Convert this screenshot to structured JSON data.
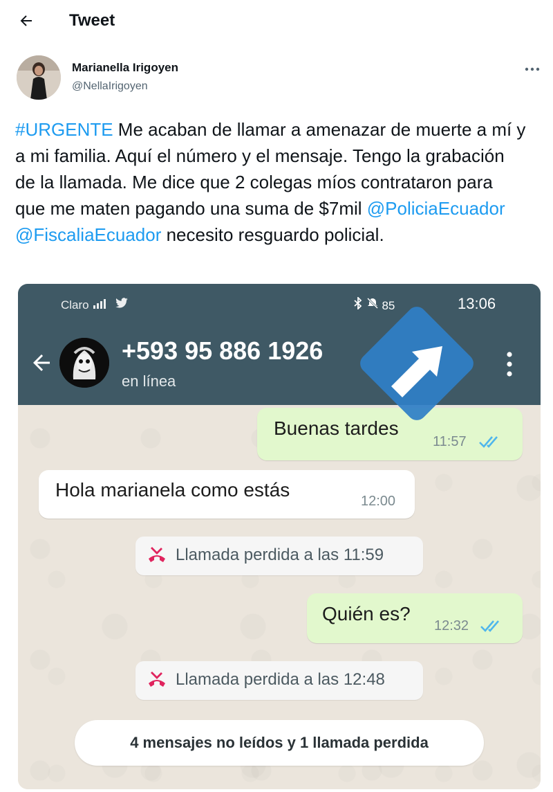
{
  "topbar": {
    "title": "Tweet"
  },
  "author": {
    "name": "Marianella Irigoyen",
    "handle": "@NellaIrigoyen"
  },
  "tweet": {
    "hashtag": "#URGENTE",
    "text_1": " Me acaban de llamar a amenazar de muerte a mí y a mi familia. Aquí el número y el mensaje. Tengo la grabación de la llamada. Me dice que 2 colegas míos contrataron para que me maten pagando una suma de $7mil ",
    "mention_1": "@PoliciaEcuador",
    "mention_2": "@FiscaliaEcuador",
    "text_2": " necesito resguardo policial."
  },
  "screenshot": {
    "status_bar": {
      "carrier": "Claro",
      "battery": "85",
      "time": "13:06"
    },
    "contact": {
      "number": "+593 95 886 1926",
      "status": "en línea"
    },
    "messages": [
      {
        "direction": "out",
        "text": "Buenas tardes",
        "time": "11:57"
      },
      {
        "direction": "in",
        "text": "Hola marianela como estás",
        "time": "12:00"
      },
      {
        "direction": "out",
        "text": "Quién es?",
        "time": "12:32"
      }
    ],
    "missed_calls": [
      "Llamada perdida a las 11:59",
      "Llamada perdida a las 12:48"
    ],
    "unread_banner": "4 mensajes no leídos y 1 llamada perdida"
  },
  "colors": {
    "link": "#1d9bf0",
    "whatsapp_header": "#3f5965",
    "outgoing_bubble": "#e2f8cd",
    "read_ticks": "#4fb6ec",
    "missed_call": "#e0245e",
    "overlay_badge": "#2f7fc6"
  },
  "icons": [
    "back-arrow-icon",
    "more-options-icon",
    "twitter-bird-icon",
    "bluetooth-icon",
    "mute-icon",
    "battery-icon",
    "menu-dots-icon",
    "missed-call-icon",
    "double-check-icon",
    "share-arrow-icon"
  ]
}
